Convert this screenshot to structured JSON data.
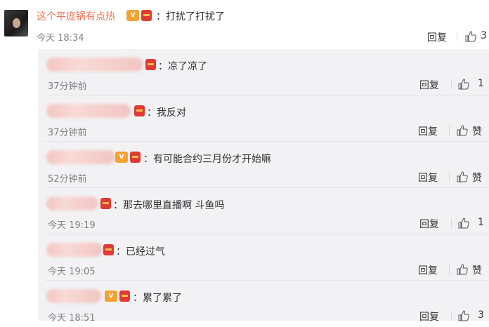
{
  "main_comment": {
    "author": "这个平庞锅有点热",
    "text": "：打扰了打扰了",
    "time": "今天 18:34",
    "reply_label": "回复",
    "likes": "3"
  },
  "replies": [
    {
      "text": "：凉了凉了",
      "time": "37分钟前",
      "reply_label": "回复",
      "likes": "1"
    },
    {
      "text": "：我反对",
      "time": "37分钟前",
      "reply_label": "回复",
      "likes": "赞"
    },
    {
      "text": "：有可能合约三月份才开始嘛",
      "time": "52分钟前",
      "reply_label": "回复",
      "likes": "赞"
    },
    {
      "text": "：那去哪里直播啊  斗鱼吗",
      "time": "今天 19:19",
      "reply_label": "回复",
      "likes": "1"
    },
    {
      "text": "：已经过气",
      "time": "今天 19:05",
      "reply_label": "回复",
      "likes": "赞"
    },
    {
      "text": "：累了累了",
      "time": "今天 18:51",
      "reply_label": "回复",
      "likes": "3"
    }
  ],
  "colors": {
    "author_name": "#eb7350",
    "reply_bg": "#f2f2f5",
    "vip": "#f3a233",
    "red_packet": "#e03a33"
  }
}
